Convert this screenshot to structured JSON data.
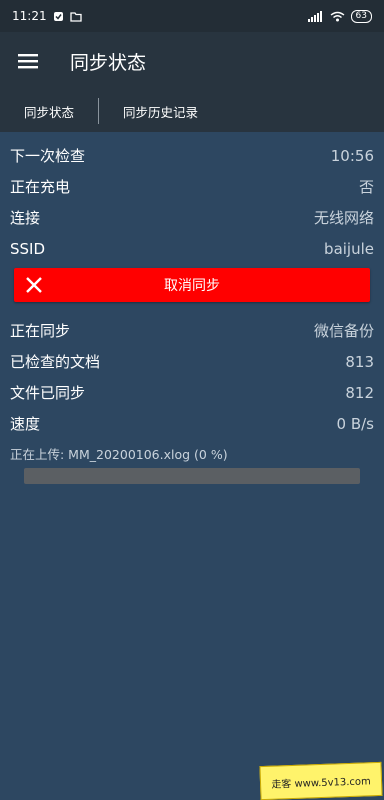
{
  "status_bar": {
    "time": "11:21",
    "battery": "63",
    "icons": [
      "notification-app-icon",
      "folder-icon",
      "signal-icon",
      "wifi-icon",
      "battery-icon"
    ]
  },
  "app_bar": {
    "menu_icon": "hamburger-menu-icon",
    "title": "同步状态"
  },
  "tabs": [
    {
      "label": "同步状态"
    },
    {
      "label": "同步历史记录"
    }
  ],
  "rows_top": [
    {
      "label": "下一次检查",
      "value": "10:56"
    },
    {
      "label": "正在充电",
      "value": "否"
    },
    {
      "label": "连接",
      "value": "无线网络"
    },
    {
      "label": "SSID",
      "value": "baijule"
    }
  ],
  "cancel_button": {
    "label": "取消同步",
    "icon": "close-icon",
    "color": "#ff0000"
  },
  "rows_bottom": [
    {
      "label": "正在同步",
      "value": "微信备份"
    },
    {
      "label": "已检查的文档",
      "value": "813"
    },
    {
      "label": "文件已同步",
      "value": "812"
    },
    {
      "label": "速度",
      "value": "0 B/s"
    }
  ],
  "upload": {
    "text": "正在上传: MM_20200106.xlog (0 %)",
    "progress_percent": 0
  },
  "watermark": {
    "text": "走客 www.5v13.com"
  },
  "colors": {
    "background": "#2d4761",
    "app_bar": "#28343f",
    "status_bar": "#232d36",
    "accent_red": "#ff0000"
  }
}
